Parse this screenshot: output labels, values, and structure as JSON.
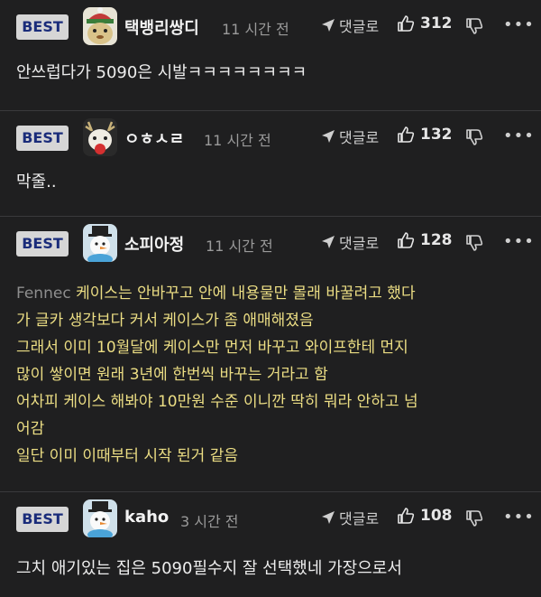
{
  "comments": [
    {
      "badge": "BEST",
      "nick": "택뱅리쌍디",
      "time": "11 시간 전",
      "reply_label": "댓글로",
      "likes": "312",
      "text": "안쓰럽다가 5090은 시발ㅋㅋㅋㅋㅋㅋㅋㅋ"
    },
    {
      "badge": "BEST",
      "nick": "ㅇㅎㅅㄹ",
      "time": "11 시간 전",
      "reply_label": "댓글로",
      "likes": "132",
      "text": "막줄.."
    },
    {
      "badge": "BEST",
      "nick": "소피아정",
      "time": "11 시간 전",
      "reply_label": "댓글로",
      "likes": "128",
      "quote_name": "Fennec",
      "lines": [
        " 케이스는 안바꾸고 안에 내용물만 몰래 바꿀려고 했다",
        "가 글카 생각보다 커서 케이스가 좀 애매해졌음",
        "그래서 이미 10월달에 케이스만 먼저 바꾸고 와이프한테 먼지",
        "많이 쌓이면 원래 3년에 한번씩 바꾸는 거라고 함",
        "어차피 케이스 해봐야 10만원 수준 이니깐 딱히 뭐라 안하고 넘",
        "어감",
        "일단 이미 이때부터 시작 된거 같음"
      ]
    },
    {
      "badge": "BEST",
      "nick": "kaho",
      "time": "3 시간 전",
      "reply_label": "댓글로",
      "likes": "108",
      "text": "그치 애기있는 집은 5090필수지 잘 선택했네 가장으로서"
    }
  ],
  "colors": {
    "background": "#1f1f20",
    "badge_bg": "#d6d6d6",
    "badge_text": "#1a2c7a",
    "quote_text": "#ecde84"
  },
  "icons": [
    "reply-arrow-icon",
    "thumbs-up-icon",
    "thumbs-down-icon",
    "more-icon"
  ]
}
